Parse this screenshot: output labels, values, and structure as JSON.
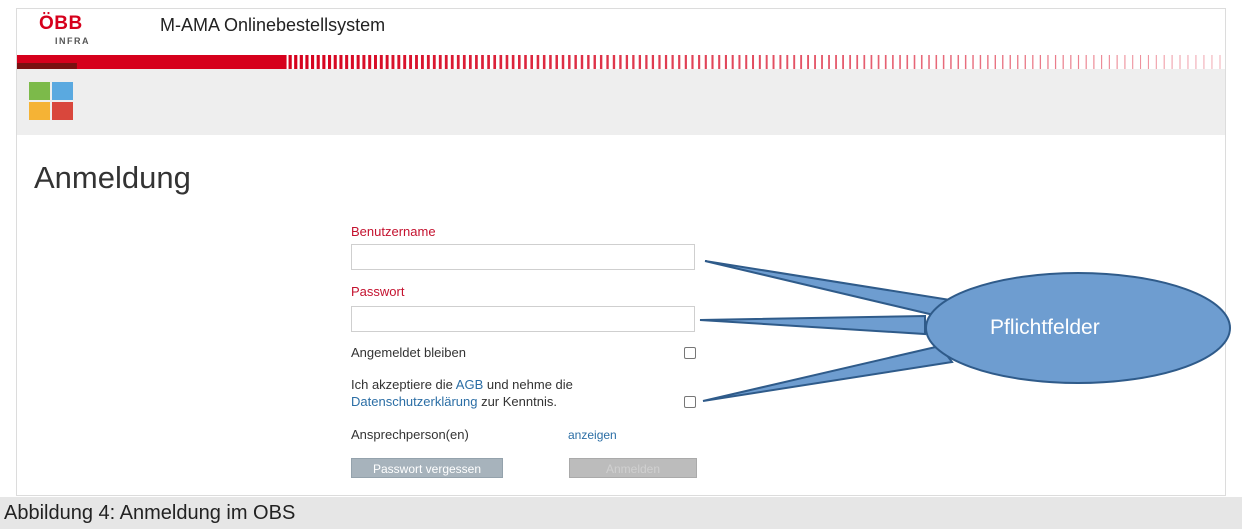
{
  "header": {
    "logo_main": "ÖBB",
    "logo_sub": "INFRA",
    "app_title": "M-AMA Onlinebestellsystem"
  },
  "colors": {
    "brand_red": "#d6001c",
    "tile_green": "#7cba4a",
    "tile_blue": "#5aa9e0",
    "tile_orange": "#f5b335",
    "tile_red": "#d9473c",
    "callout_fill": "#6e9dd0",
    "callout_stroke": "#2f5b8a"
  },
  "toolbar": {
    "app_tiles_icon": "app-tiles-icon"
  },
  "page": {
    "heading": "Anmeldung"
  },
  "form": {
    "username_label": "Benutzername",
    "password_label": "Passwort",
    "stay_logged_in_label": "Angemeldet bleiben",
    "terms_prefix": "Ich akzeptiere die ",
    "terms_link_agb": "AGB",
    "terms_middle": " und nehme die",
    "terms_link_privacy": "Datenschutzerklärung",
    "terms_suffix": " zur Kenntnis.",
    "contacts_label": "Ansprechperson(en)",
    "contacts_link": "anzeigen",
    "forgot_password_button": "Passwort vergessen",
    "login_button": "Anmelden"
  },
  "callout": {
    "label": "Pflichtfelder"
  },
  "caption": {
    "text": "Abbildung 4: Anmeldung im OBS"
  }
}
